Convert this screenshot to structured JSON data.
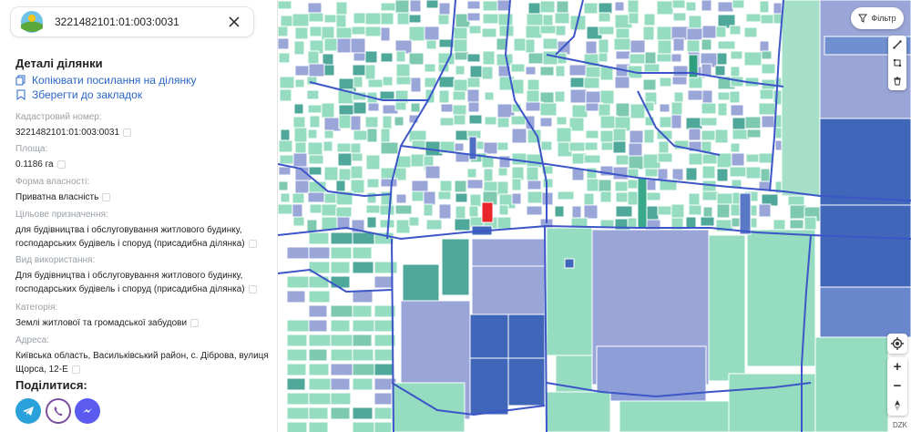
{
  "search": {
    "value": "3221482101:01:003:0031"
  },
  "details": {
    "title": "Деталі ділянки",
    "copy_link_label": "Копіювати посилання на ділянку",
    "bookmark_label": "Зберегти до закладок"
  },
  "fields": {
    "cadastral_label": "Кадастровий номер:",
    "cadastral_value": "3221482101:01:003:0031",
    "area_label": "Площа:",
    "area_value": "0.1186 га",
    "ownership_label": "Форма власності:",
    "ownership_value": "Приватна власність",
    "purpose_label": "Цільове призначення:",
    "purpose_value": "для будівництва і обслуговування житлового будинку, господарських будівель і споруд (присадибна ділянка)",
    "use_label": "Вид використання:",
    "use_value": "Для будівництва і обслуговування житлового будинку, господарських будівель і споруд (присадибна ділянка)",
    "category_label": "Категорія:",
    "category_value": "Землі житлової та громадської забудови",
    "address_label": "Адреса:",
    "address_value": "Київська область, Васильківський район, с. Діброва, вулиця Щорса, 12-Е"
  },
  "share": {
    "title": "Поділитися:",
    "buttons": [
      {
        "icon": "telegram-icon",
        "color": "#2aa1da"
      },
      {
        "icon": "viber-icon",
        "color": "#7d4fa0"
      },
      {
        "icon": "messenger-icon",
        "color": "#5b5bf0"
      }
    ]
  },
  "map": {
    "filter_label": "Фільтр",
    "attribution": "DZK",
    "colors": {
      "parcel_green": "#96dcc0",
      "parcel_teal": "#4fa89a",
      "parcel_purple": "#9aa6d8",
      "parcel_blue": "#3f66b8",
      "boundary": "#3c56c8",
      "selected": "#e8262a"
    }
  }
}
